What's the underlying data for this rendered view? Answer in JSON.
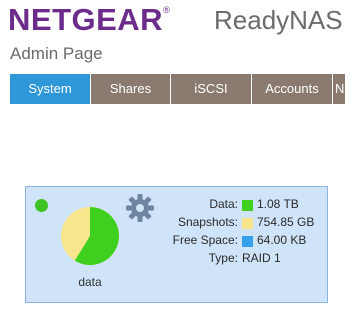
{
  "header": {
    "brand": "NETGEAR",
    "trademark": "®",
    "product": "ReadyNAS",
    "page_title": "Admin Page"
  },
  "nav": {
    "tabs": [
      {
        "label": "System",
        "active": true
      },
      {
        "label": "Shares",
        "active": false
      },
      {
        "label": "iSCSI",
        "active": false
      },
      {
        "label": "Accounts",
        "active": false
      },
      {
        "label": "N",
        "active": false
      }
    ]
  },
  "volume": {
    "name": "data",
    "status_color": "#3fc224",
    "icon": "gear-icon",
    "usage": [
      {
        "label": "Data:",
        "value": "1.08 TB",
        "color": "#3fcf1f",
        "fraction": 0.588
      },
      {
        "label": "Snapshots:",
        "value": "754.85 GB",
        "color": "#f7e68c",
        "fraction": 0.412
      },
      {
        "label": "Free Space:",
        "value": "64.00 KB",
        "color": "#36a0e8",
        "fraction": 0.0
      }
    ],
    "type_label": "Type:",
    "type_value": "RAID 1"
  },
  "colors": {
    "brand": "#6b2c8c",
    "tab_active": "#2e97d8",
    "tab_inactive": "#8a7a70",
    "card_bg": "#cfe4f8"
  }
}
